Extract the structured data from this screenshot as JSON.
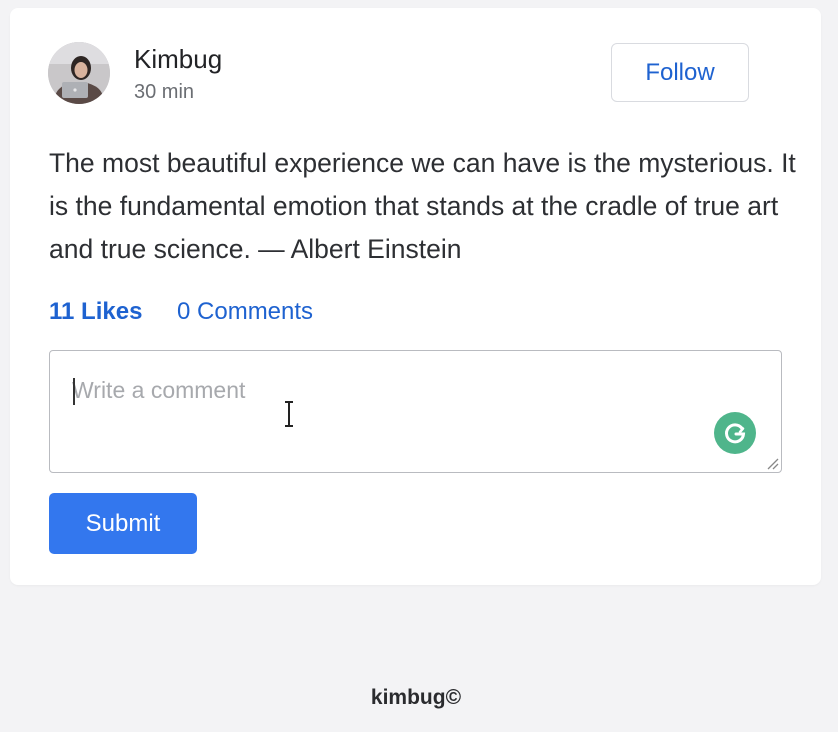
{
  "post": {
    "author": {
      "name": "Kimbug",
      "time": "30 min",
      "avatar_icon": "user-photo-avatar"
    },
    "follow_label": "Follow",
    "body": "The most beautiful experience we can have is the mysterious. It is the fundamental emotion that stands at the cradle of true art and true science. — Albert Einstein",
    "stats": {
      "likes": "11 Likes",
      "comments": "0 Comments"
    },
    "comment_form": {
      "placeholder": "Write a comment",
      "value": "",
      "submit_label": "Submit",
      "assistant_icon": "grammarly-icon"
    }
  },
  "footer": {
    "text": "kimbug©"
  },
  "colors": {
    "page_background": "#f3f3f5",
    "card_background": "#ffffff",
    "link": "#1e62d0",
    "primary_button": "#3377ee",
    "grammarly": "#4fb58b"
  }
}
